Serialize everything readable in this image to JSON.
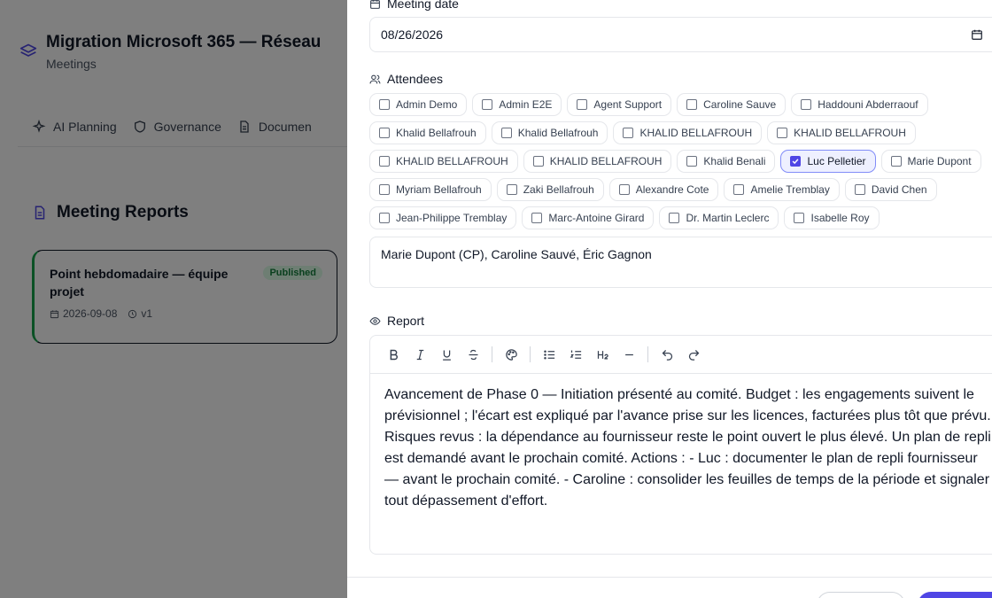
{
  "app": {
    "title": "Migration Microsoft 365 — Réseau",
    "subtitle": "Meetings",
    "logo_icon": "layers-icon"
  },
  "tabs": [
    {
      "label": "AI Planning",
      "icon": "sparkles-icon"
    },
    {
      "label": "Governance",
      "icon": "shield-icon"
    },
    {
      "label": "Documen",
      "icon": "document-icon"
    }
  ],
  "reports": {
    "title": "Meeting Reports",
    "card": {
      "title": "Point hebdomadaire — équipe projet",
      "status": "Published",
      "date": "2026-09-08",
      "version": "v1"
    }
  },
  "form": {
    "date_label": "Meeting date",
    "date_value": "08/26/2026",
    "attendees_label": "Attendees",
    "attendees": [
      {
        "name": "Admin Demo",
        "checked": false
      },
      {
        "name": "Admin E2E",
        "checked": false
      },
      {
        "name": "Agent Support",
        "checked": false
      },
      {
        "name": "Caroline Sauve",
        "checked": false
      },
      {
        "name": "Haddouni Abderraouf",
        "checked": false
      },
      {
        "name": "Khalid Bellafrouh",
        "checked": false
      },
      {
        "name": "Khalid Bellafrouh",
        "checked": false
      },
      {
        "name": "KHALID BELLAFROUH",
        "checked": false
      },
      {
        "name": "KHALID BELLAFROUH",
        "checked": false
      },
      {
        "name": "KHALID BELLAFROUH",
        "checked": false
      },
      {
        "name": "KHALID BELLAFROUH",
        "checked": false
      },
      {
        "name": "Khalid Benali",
        "checked": false
      },
      {
        "name": "Luc Pelletier",
        "checked": true
      },
      {
        "name": "Marie Dupont",
        "checked": false
      },
      {
        "name": "Myriam Bellafrouh",
        "checked": false
      },
      {
        "name": "Zaki Bellafrouh",
        "checked": false
      },
      {
        "name": "Alexandre Cote",
        "checked": false
      },
      {
        "name": "Amelie Tremblay",
        "checked": false
      },
      {
        "name": "David Chen",
        "checked": false
      },
      {
        "name": "Jean-Philippe Tremblay",
        "checked": false
      },
      {
        "name": "Marc-Antoine Girard",
        "checked": false
      },
      {
        "name": "Dr. Martin Leclerc",
        "checked": false
      },
      {
        "name": "Isabelle Roy",
        "checked": false
      }
    ],
    "attendees_text": "Marie Dupont (CP), Caroline Sauvé, Éric Gagnon",
    "report_label": "Report",
    "report_text": "Avancement de Phase 0 — Initiation présenté au comité. Budget : les engagements suivent le prévisionnel ; l'écart est expliqué par l'avance prise sur les licences, facturées plus tôt que prévu. Risques revus : la dépendance au fournisseur reste le point ouvert le plus élevé. Un plan de repli est demandé avant le prochain comité. Actions : - Luc : documenter le plan de repli fournisseur — avant le prochain comité. - Caroline : consolider les feuilles de temps de la période et signaler tout dépassement d'effort."
  },
  "colors": {
    "accent": "#4f46e5",
    "published_bg": "#dcfce7",
    "published_text": "#15803d",
    "card_border": "#16a34a"
  }
}
